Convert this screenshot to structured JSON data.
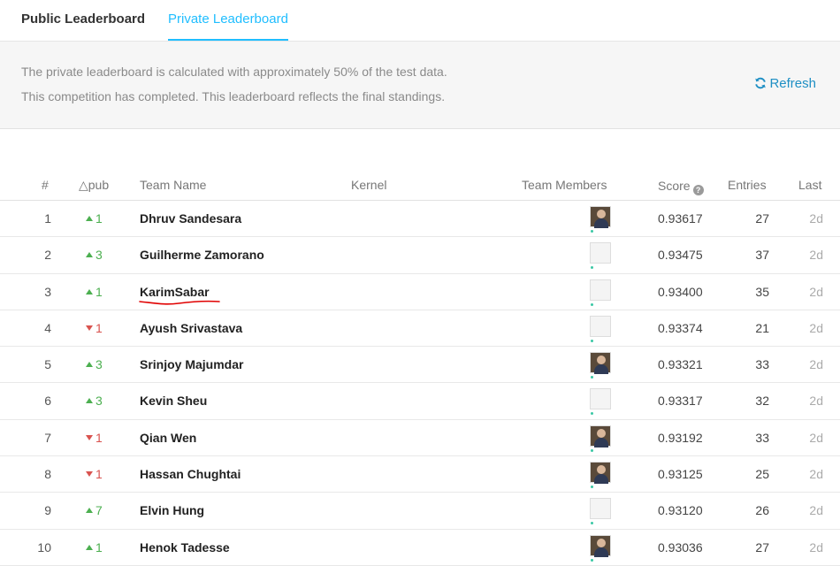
{
  "tabs": {
    "public": "Public Leaderboard",
    "private": "Private Leaderboard"
  },
  "info": {
    "line1": "The private leaderboard is calculated with approximately 50% of the test data.",
    "line2": "This competition has completed. This leaderboard reflects the final standings."
  },
  "refresh_label": "Refresh",
  "columns": {
    "rank": "#",
    "pub": "△pub",
    "team": "Team Name",
    "kernel": "Kernel",
    "members": "Team Members",
    "score": "Score",
    "entries": "Entries",
    "last": "Last"
  },
  "rows": [
    {
      "rank": "1",
      "delta": "1",
      "dir": "up",
      "team": "Dhruv Sandesara",
      "avatar": "photo",
      "score": "0.93617",
      "entries": "27",
      "last": "2d"
    },
    {
      "rank": "2",
      "delta": "3",
      "dir": "up",
      "team": "Guilherme Zamorano",
      "avatar": "default",
      "score": "0.93475",
      "entries": "37",
      "last": "2d"
    },
    {
      "rank": "3",
      "delta": "1",
      "dir": "up",
      "team": "KarimSabar",
      "avatar": "default",
      "score": "0.93400",
      "entries": "35",
      "last": "2d"
    },
    {
      "rank": "4",
      "delta": "1",
      "dir": "down",
      "team": "Ayush Srivastava",
      "avatar": "default",
      "score": "0.93374",
      "entries": "21",
      "last": "2d"
    },
    {
      "rank": "5",
      "delta": "3",
      "dir": "up",
      "team": "Srinjoy Majumdar",
      "avatar": "photo",
      "score": "0.93321",
      "entries": "33",
      "last": "2d"
    },
    {
      "rank": "6",
      "delta": "3",
      "dir": "up",
      "team": "Kevin Sheu",
      "avatar": "default",
      "score": "0.93317",
      "entries": "32",
      "last": "2d"
    },
    {
      "rank": "7",
      "delta": "1",
      "dir": "down",
      "team": "Qian Wen",
      "avatar": "photo",
      "score": "0.93192",
      "entries": "33",
      "last": "2d"
    },
    {
      "rank": "8",
      "delta": "1",
      "dir": "down",
      "team": "Hassan Chughtai",
      "avatar": "photo",
      "score": "0.93125",
      "entries": "25",
      "last": "2d"
    },
    {
      "rank": "9",
      "delta": "7",
      "dir": "up",
      "team": "Elvin Hung",
      "avatar": "default",
      "score": "0.93120",
      "entries": "26",
      "last": "2d"
    },
    {
      "rank": "10",
      "delta": "1",
      "dir": "up",
      "team": "Henok Tadesse",
      "avatar": "photo",
      "score": "0.93036",
      "entries": "27",
      "last": "2d"
    }
  ],
  "colors": {
    "accent": "#20beff",
    "up": "#4caf50",
    "down": "#d9534f",
    "annotation": "#e00000"
  }
}
